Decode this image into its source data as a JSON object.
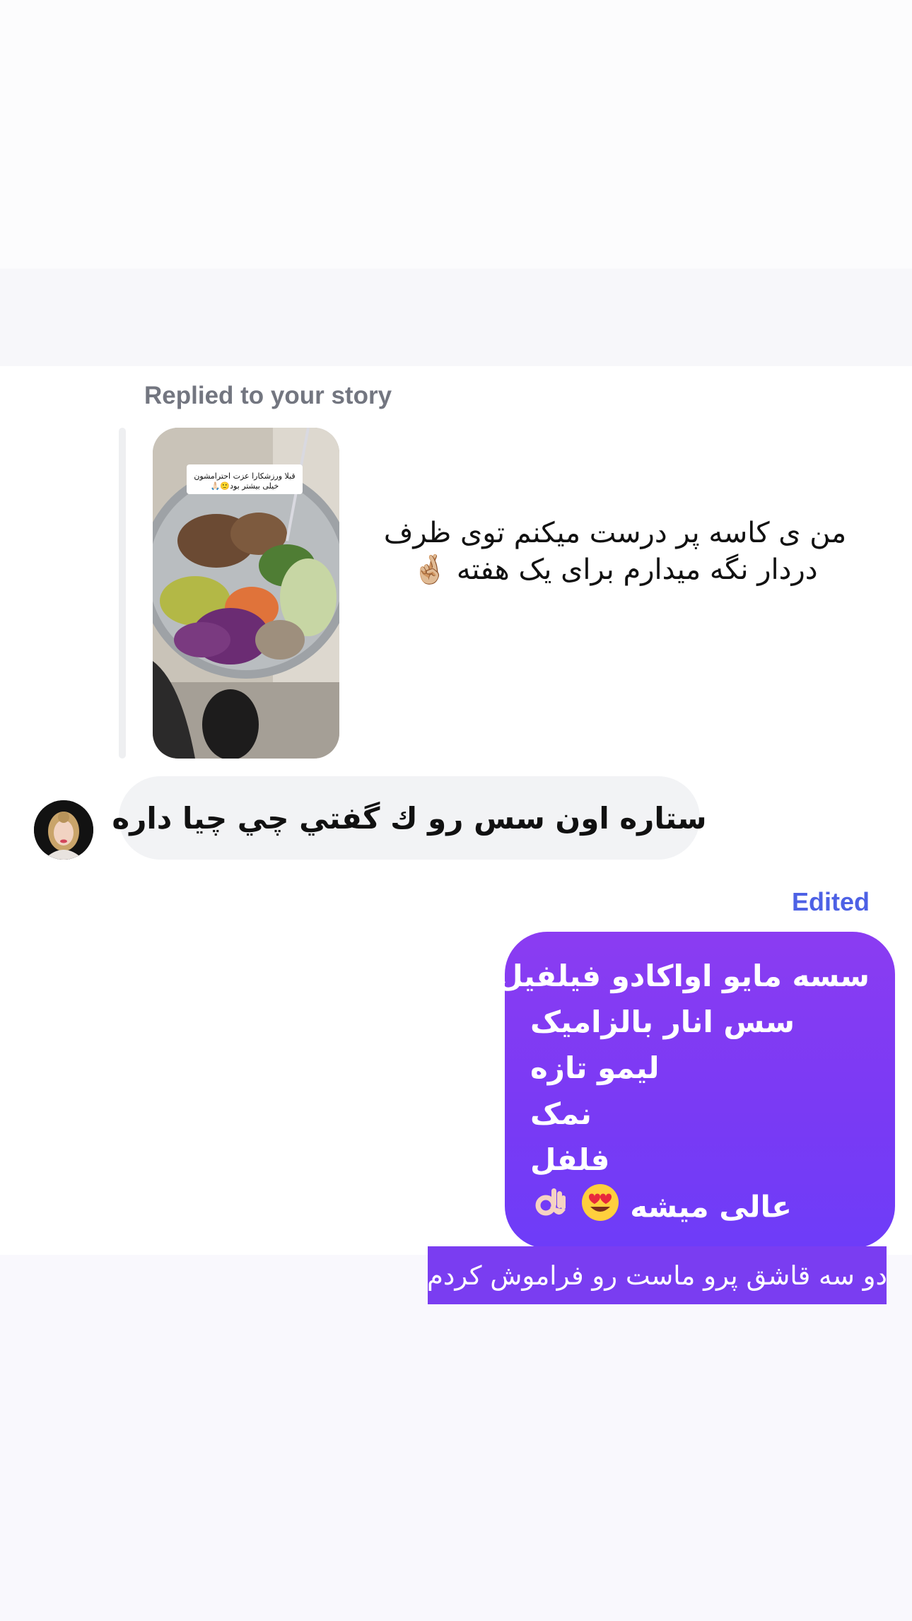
{
  "story_reply": {
    "label": "Replied to your story",
    "thumbnail_caption": "قبلا ورزشکارا عزت احترامشون خیلی بیشتر بود🙂🙏🏻",
    "story_text_line1": "من ی کاسه پر درست میکنم توی ظرف",
    "story_text_line2": "دردار نگه میدارم برای یک هفته 🤞🏼"
  },
  "incoming_message": {
    "text": "ستاره اون سس رو ك گفتي چي چيا داره"
  },
  "outgoing_message": {
    "edited_label": "Edited",
    "lines": [
      "سسه مایو اواکادو فیلفیل",
      "سس انار بالزامیک",
      "لیمو تازه",
      "نمک",
      "فلفل",
      "عالی میشه"
    ]
  },
  "reply_bar": {
    "text": "دو سه قاشق پرو ماست رو فراموش کردم"
  },
  "colors": {
    "bubble_gradient_top": "#8b3cf2",
    "bubble_gradient_bottom": "#6e3cf8",
    "edited_label": "#4d61e5",
    "incoming_bubble": "#f2f3f5"
  },
  "icons": [
    "heart-eyes-emoji",
    "ok-hand-emoji",
    "crossed-fingers-emoji",
    "user-avatar"
  ]
}
